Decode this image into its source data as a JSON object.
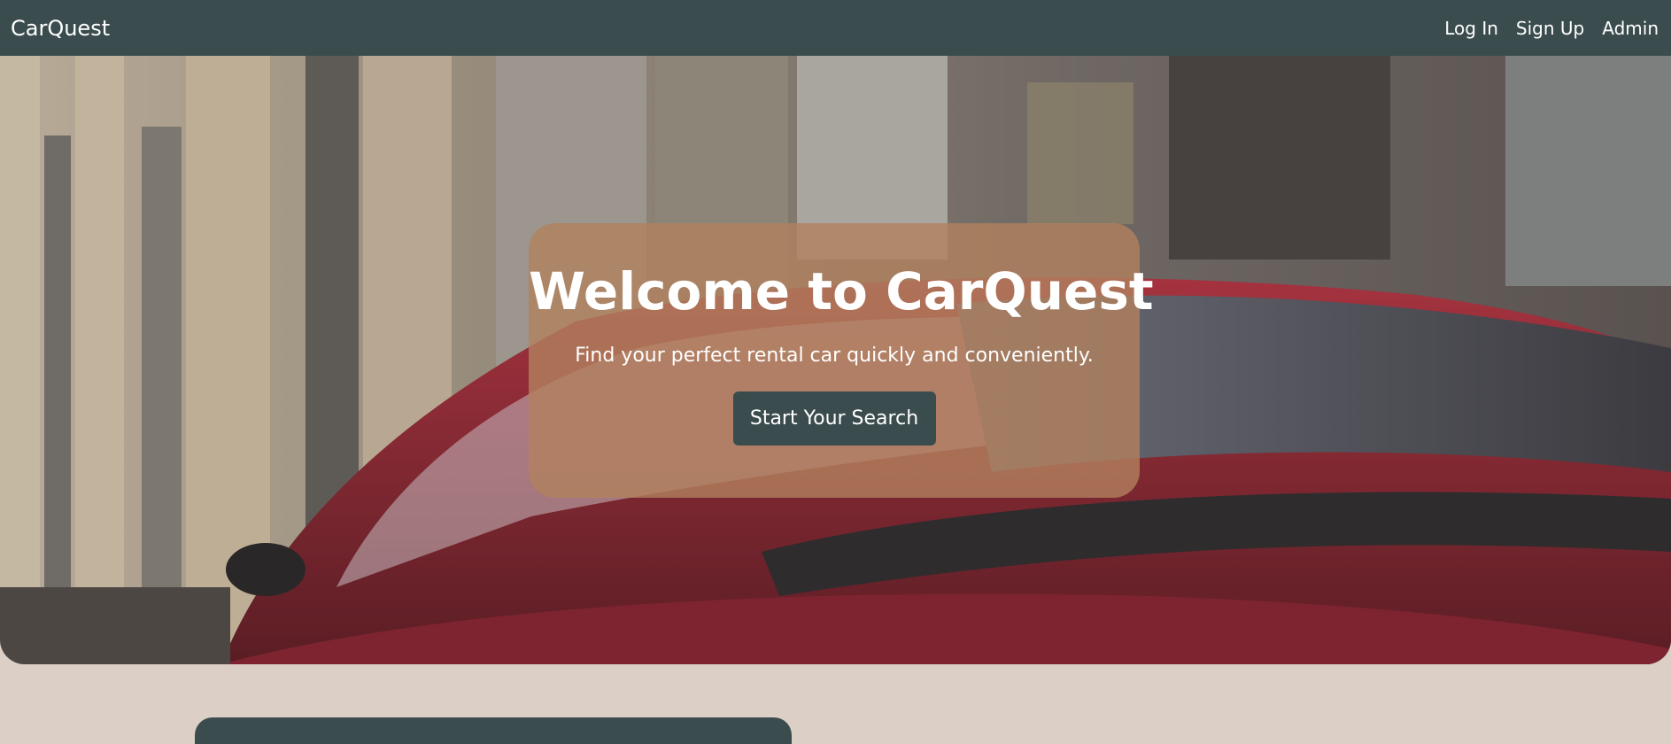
{
  "navbar": {
    "brand": "CarQuest",
    "links": [
      {
        "label": "Log In"
      },
      {
        "label": "Sign Up"
      },
      {
        "label": "Admin"
      }
    ]
  },
  "hero": {
    "title": "Welcome to CarQuest",
    "subtitle": "Find your perfect rental car quickly and conveniently.",
    "cta_label": "Start Your Search",
    "image": "red sports car parked beside a stone building facade"
  },
  "colors": {
    "navbar_bg": "#3b4c4e",
    "page_bg": "#dccfc5",
    "hero_card_bg": "#b2815e",
    "button_bg": "#3b4c4e",
    "text_light": "#ffffff"
  }
}
